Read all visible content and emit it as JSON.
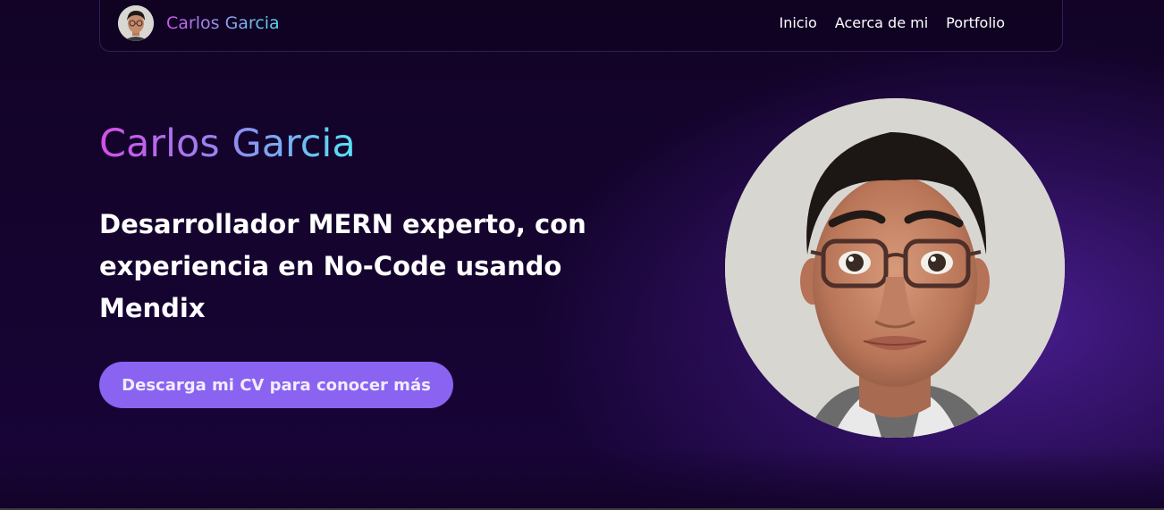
{
  "navbar": {
    "brand_name": "Carlos Garcia",
    "links": [
      "Inicio",
      "Acerca de mi",
      "Portfolio"
    ]
  },
  "hero": {
    "name": "Carlos Garcia",
    "tagline": "Desarrollador MERN experto, con experiencia en No-Code usando Mendix",
    "cv_button_label": "Descarga mi CV para conocer más"
  },
  "theme": {
    "background": "#120327",
    "accent": "#8a63f0",
    "gradient_start": "#d44fe6",
    "gradient_end": "#56e3f5"
  }
}
